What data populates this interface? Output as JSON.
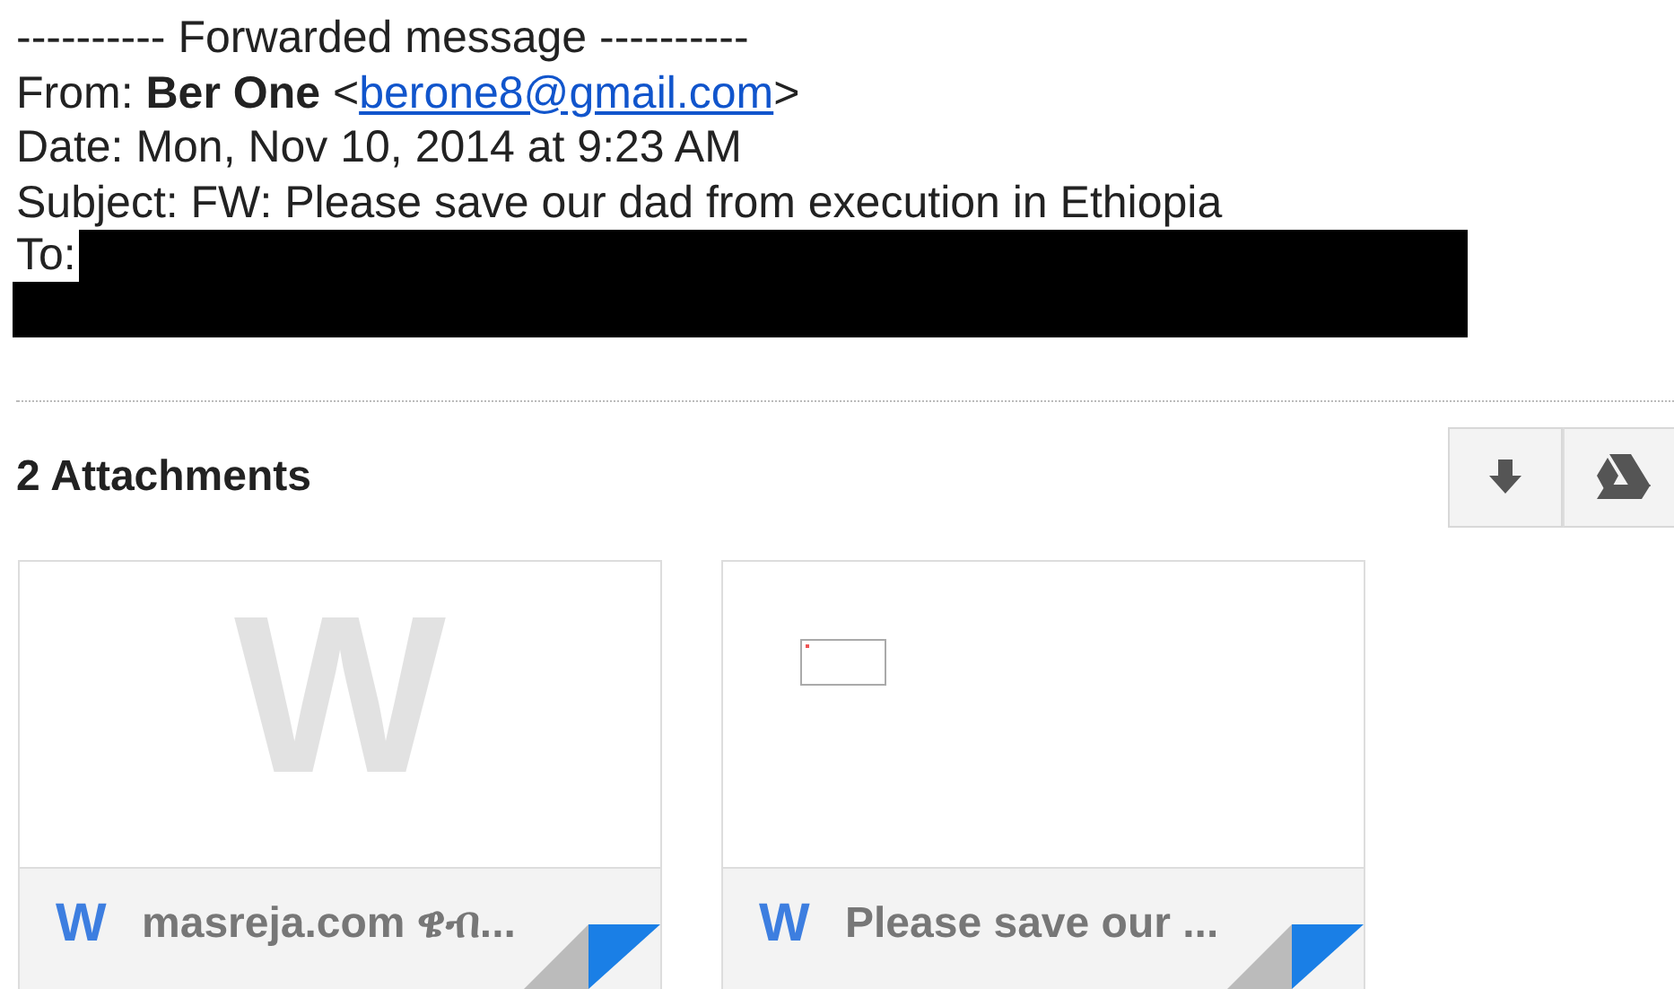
{
  "header": {
    "forwarded_line": "---------- Forwarded message ----------",
    "from_label": "From:",
    "from_name": "Ber One",
    "open_bracket": "<",
    "from_email": "berone8@gmail.com",
    "close_bracket": ">",
    "date": "Date: Mon, Nov 10, 2014 at 9:23 AM",
    "subject": "Subject: FW: Please save our dad from execution in Ethiopia",
    "to_label": "To:"
  },
  "attachments": {
    "title": "2 Attachments",
    "items": [
      {
        "kind": "letter",
        "preview_letter": "W",
        "name": "masreja.com ዌብ...",
        "icon_letter": "W"
      },
      {
        "kind": "thumbnail",
        "name": "Please save our ...",
        "icon_letter": "W"
      }
    ]
  }
}
